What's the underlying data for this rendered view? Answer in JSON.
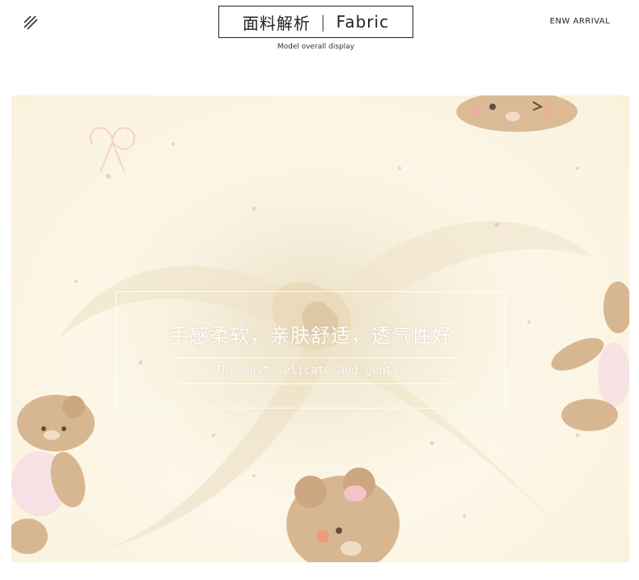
{
  "header": {
    "title_cn": "面料解析",
    "title_sep": "|",
    "title_en": "Fabric",
    "subtitle": "Model overall display",
    "arrival": "ENW ARRIVAL",
    "menu_icon": "diagonal-lines-icon"
  },
  "banner": {
    "headline": "手感柔软，亲肤舒适，透气性好",
    "tagline": "The most selicate and gentle"
  }
}
